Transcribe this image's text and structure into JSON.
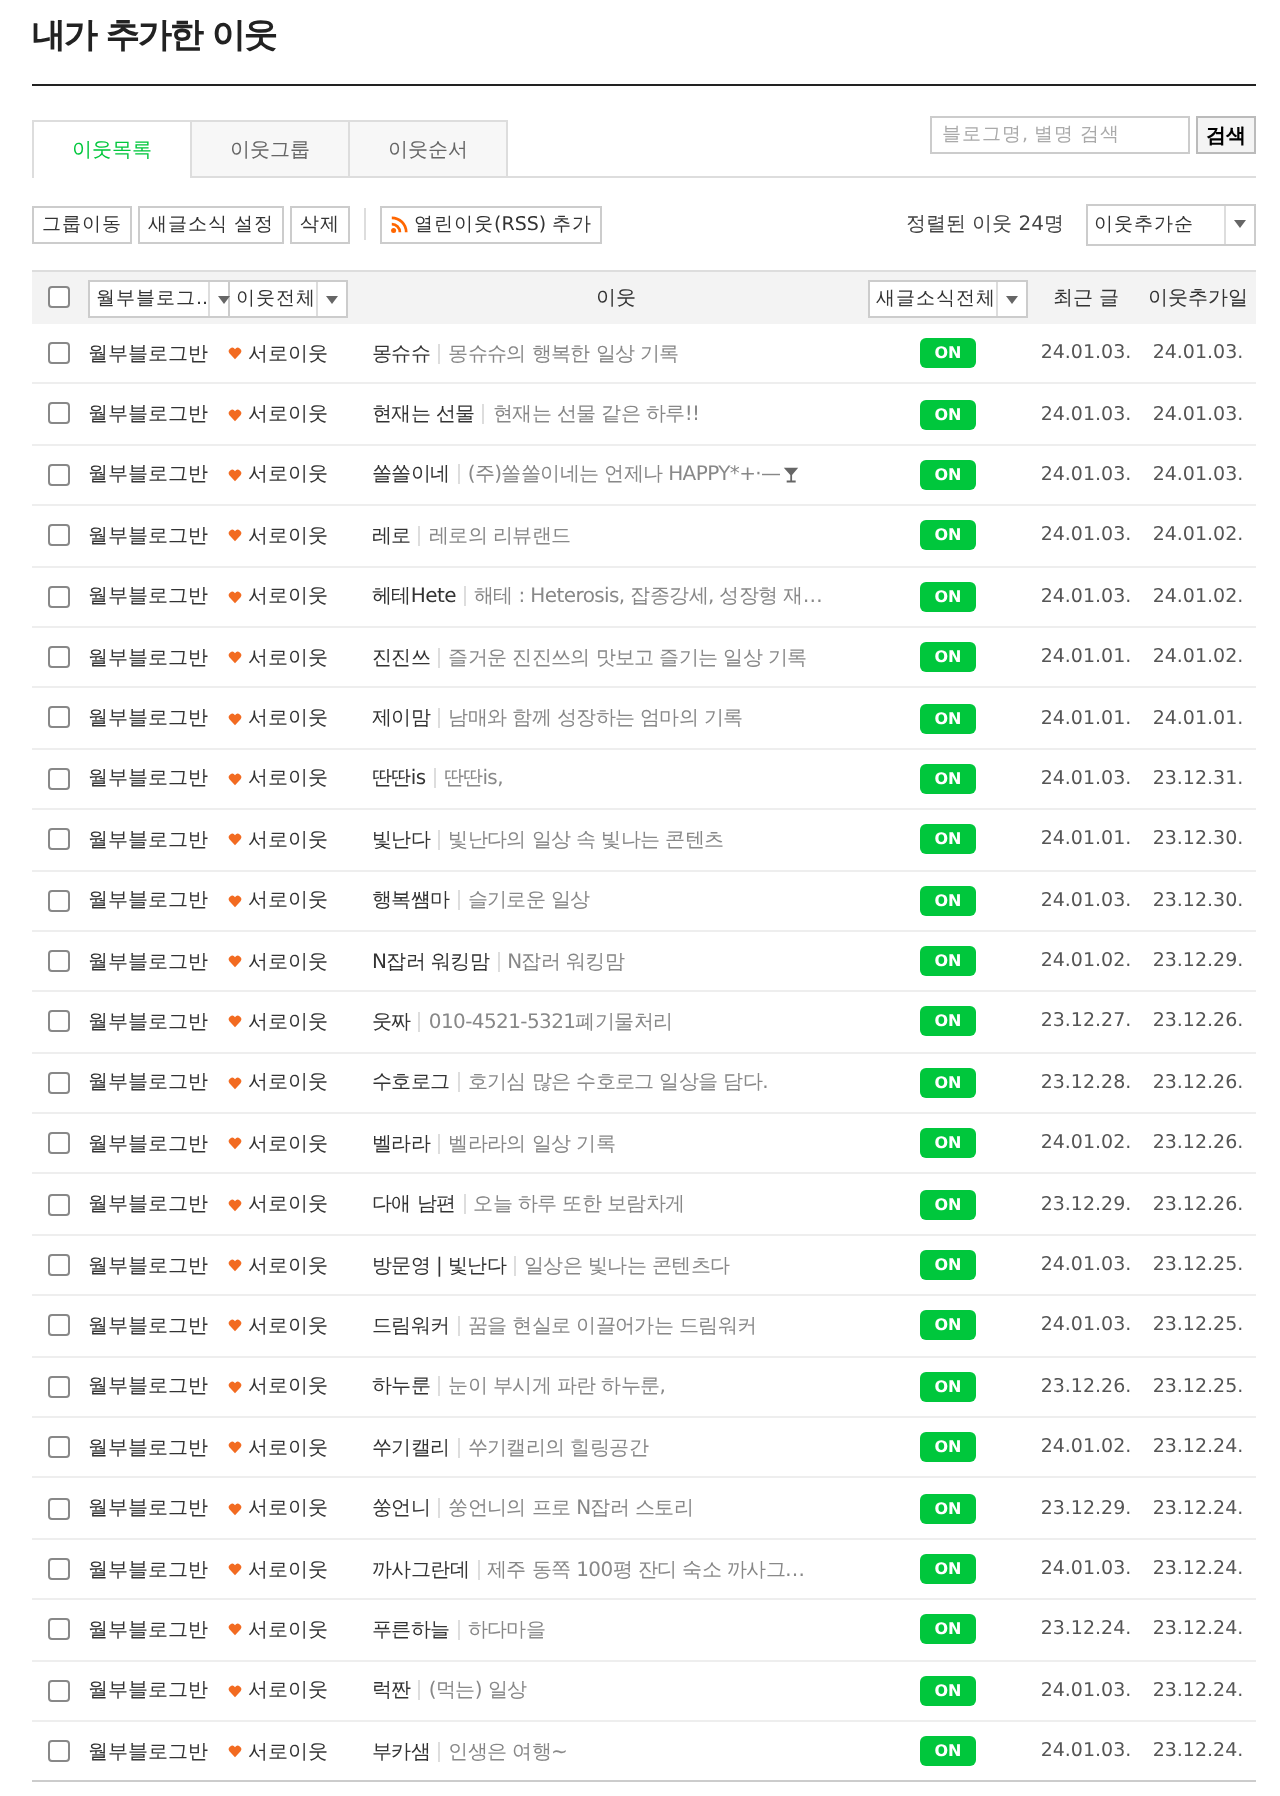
{
  "page_title": "내가 추가한 이웃",
  "tabs": [
    {
      "label": "이웃목록",
      "selected": true
    },
    {
      "label": "이웃그룹",
      "selected": false
    },
    {
      "label": "이웃순서",
      "selected": false
    }
  ],
  "search": {
    "placeholder": "블로그명, 별명 검색",
    "button": "검색"
  },
  "toolbar": {
    "buttons": [
      "그룹이동",
      "새글소식 설정",
      "삭제"
    ],
    "rss_button": "열린이웃(RSS) 추가",
    "count": "정렬된 이웃 24명",
    "sort": "이웃추가순"
  },
  "header": {
    "checked": false,
    "group_filter": "월부블로그..",
    "relation_filter": "이웃전체",
    "neighbor": "이웃",
    "news_filter": "새글소식전체",
    "recent": "최근 글",
    "added": "이웃추가일"
  },
  "rows": [
    {
      "checked": false,
      "group": "월부블로그반",
      "relation": "서로이웃",
      "name": "몽슈슈",
      "desc": "몽슈슈의 행복한 일상 기록",
      "news": "ON",
      "on": true,
      "recent": "24.01.03.",
      "added": "24.01.03."
    },
    {
      "checked": false,
      "group": "월부블로그반",
      "relation": "서로이웃",
      "name": "현재는 선물",
      "desc": "현재는 선물 같은 하루!!",
      "news": "ON",
      "on": true,
      "recent": "24.01.03.",
      "added": "24.01.03."
    },
    {
      "checked": false,
      "group": "월부블로그반",
      "relation": "서로이웃",
      "name": "쏠쏠이네",
      "desc": "(주)쏠쏠이네는 언제나 HAPPY*+·—",
      "cup": true,
      "news": "ON",
      "on": true,
      "recent": "24.01.03.",
      "added": "24.01.03."
    },
    {
      "checked": false,
      "group": "월부블로그반",
      "relation": "서로이웃",
      "name": "레로",
      "desc": "레로의 리뷰랜드",
      "news": "ON",
      "on": true,
      "recent": "24.01.03.",
      "added": "24.01.02."
    },
    {
      "checked": false,
      "group": "월부블로그반",
      "relation": "서로이웃",
      "name": "헤테Hete",
      "desc": "해테 : Heterosis, 잡종강세, 성장형 재…",
      "news": "ON",
      "on": true,
      "recent": "24.01.03.",
      "added": "24.01.02."
    },
    {
      "checked": false,
      "group": "월부블로그반",
      "relation": "서로이웃",
      "name": "진진쓰",
      "desc": "즐거운 진진쓰의 맛보고 즐기는 일상 기록",
      "news": "ON",
      "on": true,
      "recent": "24.01.01.",
      "added": "24.01.02."
    },
    {
      "checked": false,
      "group": "월부블로그반",
      "relation": "서로이웃",
      "name": "제이맘",
      "desc": "남매와 함께 성장하는 엄마의 기록",
      "news": "ON",
      "on": true,
      "recent": "24.01.01.",
      "added": "24.01.01."
    },
    {
      "checked": false,
      "group": "월부블로그반",
      "relation": "서로이웃",
      "name": "딴딴is",
      "desc": "딴딴is,",
      "news": "ON",
      "on": true,
      "recent": "24.01.03.",
      "added": "23.12.31."
    },
    {
      "checked": false,
      "group": "월부블로그반",
      "relation": "서로이웃",
      "name": "빛난다",
      "desc": "빛난다의 일상 속 빛나는 콘텐츠",
      "news": "ON",
      "on": true,
      "recent": "24.01.01.",
      "added": "23.12.30."
    },
    {
      "checked": false,
      "group": "월부블로그반",
      "relation": "서로이웃",
      "name": "행복썜마",
      "desc": "슬기로운 일상",
      "news": "ON",
      "on": true,
      "recent": "24.01.03.",
      "added": "23.12.30."
    },
    {
      "checked": false,
      "group": "월부블로그반",
      "relation": "서로이웃",
      "name": "N잡러 워킹맘",
      "desc": "N잡러 워킹맘",
      "news": "ON",
      "on": true,
      "recent": "24.01.02.",
      "added": "23.12.29."
    },
    {
      "checked": false,
      "group": "월부블로그반",
      "relation": "서로이웃",
      "name": "웃짜",
      "desc": "010-4521-5321폐기물처리",
      "news": "ON",
      "on": true,
      "recent": "23.12.27.",
      "added": "23.12.26."
    },
    {
      "checked": false,
      "group": "월부블로그반",
      "relation": "서로이웃",
      "name": "수호로그",
      "desc": "호기심 많은 수호로그 일상을 담다.",
      "news": "ON",
      "on": true,
      "recent": "23.12.28.",
      "added": "23.12.26."
    },
    {
      "checked": false,
      "group": "월부블로그반",
      "relation": "서로이웃",
      "name": "벨라라",
      "desc": "벨라라의 일상 기록",
      "news": "ON",
      "on": true,
      "recent": "24.01.02.",
      "added": "23.12.26."
    },
    {
      "checked": false,
      "group": "월부블로그반",
      "relation": "서로이웃",
      "name": "다애 남편",
      "desc": "오늘 하루 또한 보람차게",
      "news": "ON",
      "on": true,
      "recent": "23.12.29.",
      "added": "23.12.26."
    },
    {
      "checked": false,
      "group": "월부블로그반",
      "relation": "서로이웃",
      "name": "방문영 | 빛난다",
      "desc": "일상은 빛나는 콘텐츠다",
      "news": "ON",
      "on": true,
      "recent": "24.01.03.",
      "added": "23.12.25."
    },
    {
      "checked": false,
      "group": "월부블로그반",
      "relation": "서로이웃",
      "name": "드림워커",
      "desc": "꿈을 현실로 이끌어가는 드림워커",
      "news": "ON",
      "on": true,
      "recent": "24.01.03.",
      "added": "23.12.25."
    },
    {
      "checked": false,
      "group": "월부블로그반",
      "relation": "서로이웃",
      "name": "하누룬",
      "desc": "눈이 부시게 파란 하누룬,",
      "news": "ON",
      "on": true,
      "recent": "23.12.26.",
      "added": "23.12.25."
    },
    {
      "checked": false,
      "group": "월부블로그반",
      "relation": "서로이웃",
      "name": "쑤기캘리",
      "desc": "쑤기캘리의 힐링공간",
      "news": "ON",
      "on": true,
      "recent": "24.01.02.",
      "added": "23.12.24."
    },
    {
      "checked": false,
      "group": "월부블로그반",
      "relation": "서로이웃",
      "name": "쑹언니",
      "desc": "쑹언니의 프로 N잡러 스토리",
      "news": "ON",
      "on": true,
      "recent": "23.12.29.",
      "added": "23.12.24."
    },
    {
      "checked": false,
      "group": "월부블로그반",
      "relation": "서로이웃",
      "name": "까사그란데",
      "desc": "제주 동쪽 100평 잔디 숙소 까사그…",
      "news": "ON",
      "on": true,
      "recent": "24.01.03.",
      "added": "23.12.24."
    },
    {
      "checked": false,
      "group": "월부블로그반",
      "relation": "서로이웃",
      "name": "푸른하늘",
      "desc": "하다마을",
      "news": "ON",
      "on": true,
      "recent": "23.12.24.",
      "added": "23.12.24."
    },
    {
      "checked": false,
      "group": "월부블로그반",
      "relation": "서로이웃",
      "name": "럭짠",
      "desc": "(먹는) 일상",
      "news": "ON",
      "on": true,
      "recent": "24.01.03.",
      "added": "23.12.24."
    },
    {
      "checked": false,
      "group": "월부블로그반",
      "relation": "서로이웃",
      "name": "부카샘",
      "desc": "인생은 여행~",
      "news": "ON",
      "on": true,
      "recent": "24.01.03.",
      "added": "23.12.24."
    }
  ]
}
